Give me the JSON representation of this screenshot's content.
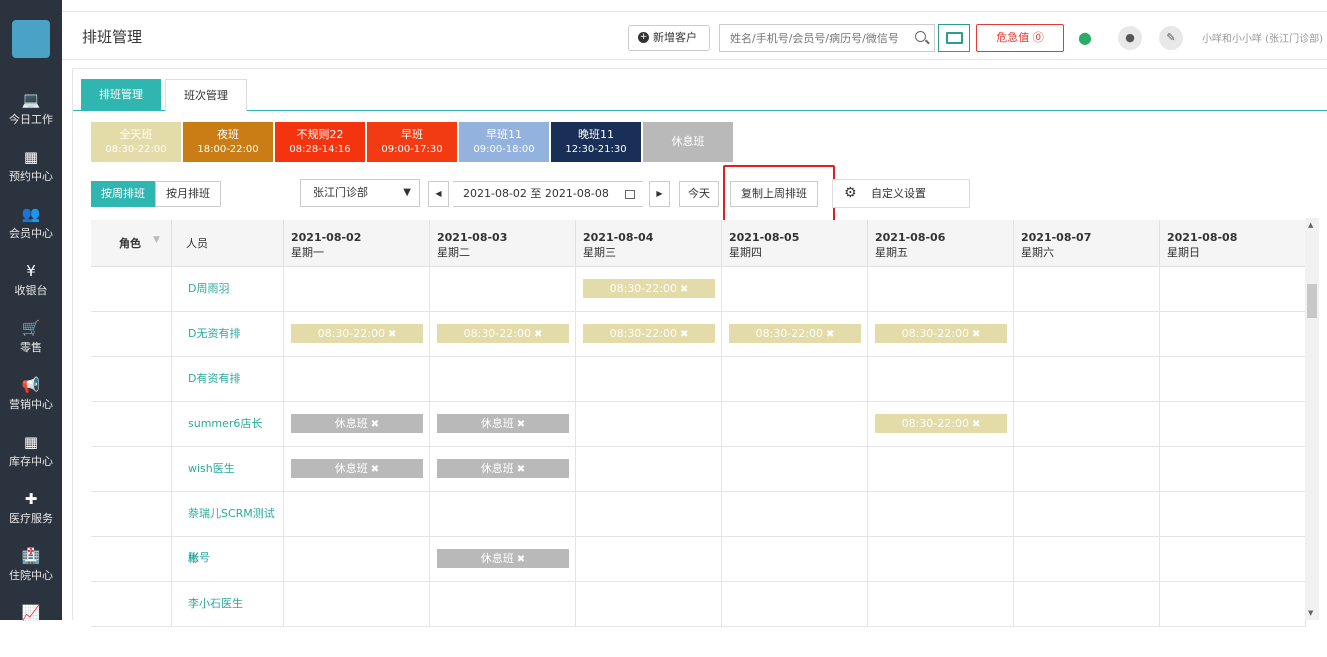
{
  "sidebar": {
    "items": [
      {
        "label": "今日工作",
        "icon": "laptop-icon",
        "glyph": "💻"
      },
      {
        "label": "预约中心",
        "icon": "calendar-icon",
        "glyph": "▦"
      },
      {
        "label": "会员中心",
        "icon": "users-icon",
        "glyph": "👥"
      },
      {
        "label": "收银台",
        "icon": "yen-icon",
        "glyph": "¥"
      },
      {
        "label": "零售",
        "icon": "cart-icon",
        "glyph": "🛒"
      },
      {
        "label": "营销中心",
        "icon": "megaphone-icon",
        "glyph": "📢"
      },
      {
        "label": "库存中心",
        "icon": "grid-icon",
        "glyph": "▦"
      },
      {
        "label": "医疗服务",
        "icon": "medkit-icon",
        "glyph": "✚"
      },
      {
        "label": "住院中心",
        "icon": "hospital-icon",
        "glyph": "🏥"
      },
      {
        "label": "",
        "icon": "chart-icon",
        "glyph": "📈"
      }
    ]
  },
  "header": {
    "title": "排班管理",
    "new_customer": "新增客户",
    "search_placeholder": "姓名/手机号/会员号/病历号/微信号",
    "danger_label": "危急值 ⓪",
    "user": "小咩和小小咩 (张江门诊部)"
  },
  "tabs": [
    "排班管理",
    "班次管理"
  ],
  "shifts": [
    {
      "name": "全天班",
      "time": "08:30-22:00",
      "color": "#e3dba8"
    },
    {
      "name": "夜班",
      "time": "18:00-22:00",
      "color": "#c97d14"
    },
    {
      "name": "不规则22",
      "time": "08:28-14:16",
      "color": "#f3340f"
    },
    {
      "name": "早班",
      "time": "09:00-17:30",
      "color": "#f23b13"
    },
    {
      "name": "早班11",
      "time": "09:00-18:00",
      "color": "#93b3de"
    },
    {
      "name": "晚班11",
      "time": "12:30-21:30",
      "color": "#1a2f57"
    },
    {
      "name": "休息班",
      "time": "",
      "color": "#b9b9b9"
    }
  ],
  "controls": {
    "view_week": "按周排班",
    "view_month": "按月排班",
    "clinic": "张江门诊部",
    "date_range": "2021-08-02 至 2021-08-08",
    "today": "今天",
    "copy_last_week": "复制上周排班",
    "custom_settings": "自定义设置"
  },
  "table": {
    "role_header": "角色",
    "person_header": "人员",
    "days": [
      {
        "date": "2021-08-02",
        "weekday": "星期一"
      },
      {
        "date": "2021-08-03",
        "weekday": "星期二"
      },
      {
        "date": "2021-08-04",
        "weekday": "星期三"
      },
      {
        "date": "2021-08-05",
        "weekday": "星期四"
      },
      {
        "date": "2021-08-06",
        "weekday": "星期五"
      },
      {
        "date": "2021-08-07",
        "weekday": "星期六"
      },
      {
        "date": "2021-08-08",
        "weekday": "星期日"
      }
    ],
    "rows": [
      {
        "name": "D周雨羽",
        "cells": [
          "",
          "",
          "08:30-22:00",
          "",
          "",
          "",
          ""
        ]
      },
      {
        "name": "D无资有排",
        "cells": [
          "08:30-22:00",
          "08:30-22:00",
          "08:30-22:00",
          "08:30-22:00",
          "08:30-22:00",
          "",
          ""
        ]
      },
      {
        "name": "D有资有排",
        "cells": [
          "",
          "",
          "",
          "",
          "",
          "",
          ""
        ]
      },
      {
        "name": "summer6店长",
        "cells": [
          "休息班",
          "休息班",
          "",
          "",
          "08:30-22:00",
          "",
          ""
        ]
      },
      {
        "name": "wish医生",
        "cells": [
          "休息班",
          "休息班",
          "",
          "",
          "",
          "",
          ""
        ]
      },
      {
        "name": "萘瑞儿SCRM测试账号",
        "cells": [
          "",
          "",
          "",
          "",
          "",
          "",
          ""
        ]
      },
      {
        "name": "彬",
        "cells": [
          "",
          "休息班",
          "",
          "",
          "",
          "",
          ""
        ]
      },
      {
        "name": "李小石医生",
        "cells": [
          "",
          "",
          "",
          "",
          "",
          "",
          ""
        ]
      }
    ]
  }
}
